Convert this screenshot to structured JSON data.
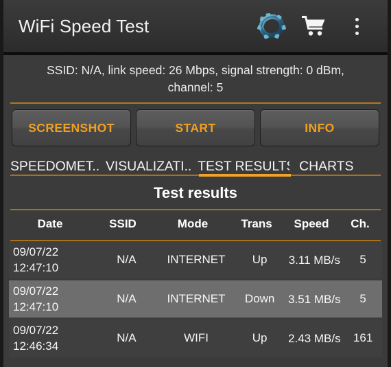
{
  "titlebar": {
    "title": "WiFi Speed Test",
    "icons": {
      "gear": "gear-ring-icon",
      "cart": "shopping-cart-icon",
      "overflow": "overflow-menu-icon"
    }
  },
  "status": {
    "line1": "SSID: N/A, link speed: 26 Mbps, signal strength: 0 dBm,",
    "line2": "channel: 5"
  },
  "actions": {
    "screenshot": "SCREENSHOT",
    "start": "START",
    "info": "INFO"
  },
  "tabs": {
    "items": [
      {
        "label": "SPEEDOMET..",
        "active": false
      },
      {
        "label": "VISUALIZATI..",
        "active": false
      },
      {
        "label": "TEST RESULTS",
        "active": true
      },
      {
        "label": "CHARTS",
        "active": false
      }
    ]
  },
  "results": {
    "title": "Test results",
    "columns": [
      "Date",
      "SSID",
      "Mode",
      "Trans",
      "Speed",
      "Ch."
    ],
    "rows": [
      {
        "date_line1": "09/07/22",
        "date_line2": "12:47:10",
        "ssid": "N/A",
        "mode": "INTERNET",
        "trans": "Up",
        "speed": "3.11 MB/s",
        "ch": "5",
        "highlight": false
      },
      {
        "date_line1": "09/07/22",
        "date_line2": "12:47:10",
        "ssid": "N/A",
        "mode": "INTERNET",
        "trans": "Down",
        "speed": "3.51 MB/s",
        "ch": "5",
        "highlight": true
      },
      {
        "date_line1": "09/07/22",
        "date_line2": "12:46:34",
        "ssid": "N/A",
        "mode": "WIFI",
        "trans": "Up",
        "speed": "2.43 MB/s",
        "ch": "161",
        "highlight": false
      }
    ]
  },
  "colors": {
    "accent_orange": "#f2a229",
    "rule_orange": "#a8721c",
    "button_text": "#f0a020",
    "background": "#3b3b3b",
    "titlebar": "#333333",
    "row_dark": "#3f3f3f",
    "row_light": "#6e6e6e",
    "gear_icon": "#2e6e8e"
  }
}
